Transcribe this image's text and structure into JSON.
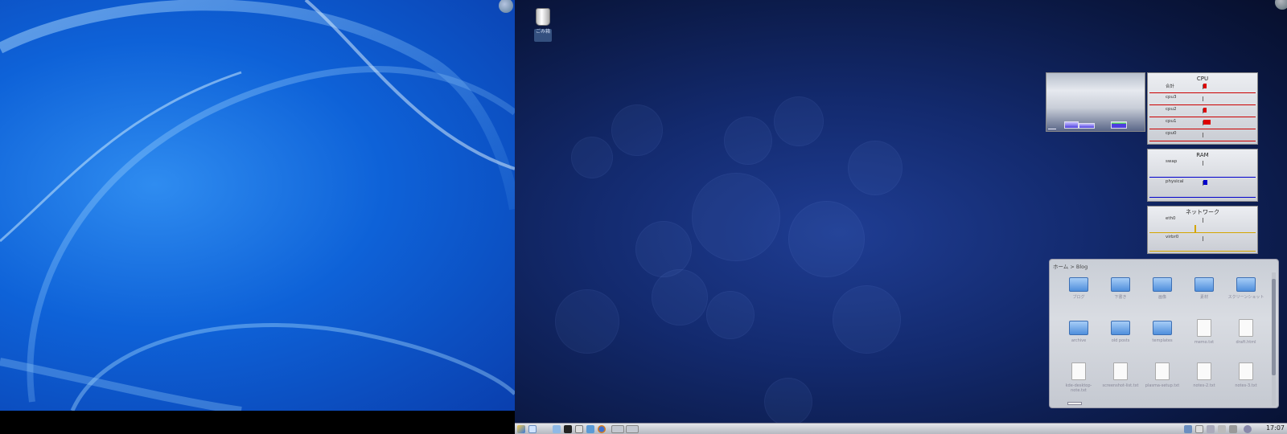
{
  "colors": {
    "left_bg": "#0e62d8",
    "right_bg": "#132a6e",
    "cpu_line": "#cc0000",
    "ram_line": "#0000cc",
    "net_line": "#d4a500"
  },
  "desktop": {
    "trash": {
      "icon": "trash-icon",
      "label": "ごみ箱"
    }
  },
  "widgets": {
    "cpu": {
      "title": "CPU",
      "rows": [
        "合計",
        "cpu3",
        "cpu2",
        "cpu1",
        "cpu0"
      ]
    },
    "ram": {
      "title": "RAM",
      "rows": [
        "swap",
        "physical"
      ]
    },
    "network": {
      "title": "ネットワーク",
      "rows": [
        "eth0",
        "virbr0"
      ]
    }
  },
  "folderview": {
    "path": "ホーム > Blog",
    "items": [
      {
        "type": "folder",
        "name": "ブログ"
      },
      {
        "type": "folder",
        "name": "下書き"
      },
      {
        "type": "folder",
        "name": "画像"
      },
      {
        "type": "folder",
        "name": "素材"
      },
      {
        "type": "folder",
        "name": "スクリーンショット"
      },
      {
        "type": "folder",
        "name": "archive"
      },
      {
        "type": "folder",
        "name": "old posts"
      },
      {
        "type": "folder",
        "name": "templates"
      },
      {
        "type": "file",
        "name": "memo.txt"
      },
      {
        "type": "file",
        "name": "draft.html"
      },
      {
        "type": "file",
        "name": "kde-desktop-note.txt"
      },
      {
        "type": "file",
        "name": "screenshot-list.txt"
      },
      {
        "type": "file",
        "name": "plasma-setup.txt"
      },
      {
        "type": "file",
        "name": "notes-2.txt"
      },
      {
        "type": "file",
        "name": "notes-3.txt"
      }
    ]
  },
  "taskbar": {
    "clock": "17:07"
  }
}
